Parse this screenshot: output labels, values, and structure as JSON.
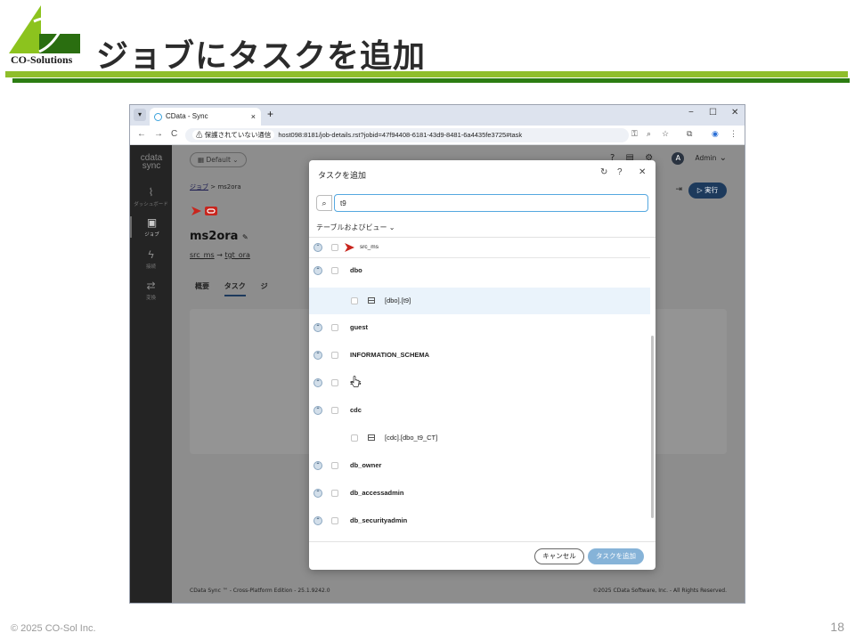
{
  "slide": {
    "logo_text": "CO-Solutions",
    "title": "ジョブにタスクを追加",
    "copyright": "© 2025 CO-Sol Inc.",
    "page_number": "18",
    "colors": {
      "rule_light": "#8fbe2b",
      "rule_dark": "#2c7d12"
    }
  },
  "browser": {
    "tab_title": "CData - Sync",
    "tab_close": "×",
    "new_tab": "+",
    "window_controls": [
      "−",
      "☐",
      "✕"
    ],
    "nav": [
      "←",
      "→",
      "C"
    ],
    "security_label": "保護されていない通信",
    "url": "host098:8181/job-details.rst?jobid=47f94408-6181-43d9-8481-6a4435fe3725#task"
  },
  "app": {
    "brand_top": "cdata",
    "brand_bottom": "sync",
    "sidebar": [
      {
        "icon": "chart-icon",
        "glyph": "⌇",
        "label": "ダッシュボード"
      },
      {
        "icon": "briefcase-icon",
        "glyph": "▣",
        "label": "ジョブ",
        "active": true
      },
      {
        "icon": "bolt-icon",
        "glyph": "ϟ",
        "label": "接続"
      },
      {
        "icon": "transform-icon",
        "glyph": "⇄",
        "label": "変換"
      }
    ],
    "workspace": "Default",
    "user": {
      "initial": "A",
      "name": "Admin"
    },
    "breadcrumb": {
      "parent": "ジョブ",
      "sep": ">",
      "current": "ms2ora"
    },
    "job_title": "ms2ora",
    "route": {
      "source": "src_ms",
      "arrow": "→",
      "target": "tgt_ora"
    },
    "subtabs": [
      "概要",
      "タスク",
      "ジ"
    ],
    "run_button": "▷ 実行",
    "footer_left": "CData Sync ™ - Cross-Platform Edition - 25.1.9242.0",
    "footer_right": "©2025 CData Software, Inc. - All Rights Reserved."
  },
  "modal": {
    "title": "タスクを追加",
    "search_value": "t9",
    "filter_label": "テーブルおよびビュー",
    "connection": "src_ms",
    "schemas": [
      "dbo",
      "guest",
      "INFORMATION_SCHEMA",
      "sys",
      "cdc",
      "db_owner",
      "db_accessadmin",
      "db_securityadmin"
    ],
    "tables": [
      {
        "schema": "dbo",
        "name": "[dbo].[t9]"
      },
      {
        "schema": "cdc",
        "name": "[cdc].[dbo_t9_CT]"
      }
    ],
    "cancel_label": "キャンセル",
    "add_label": "タスクを追加"
  }
}
